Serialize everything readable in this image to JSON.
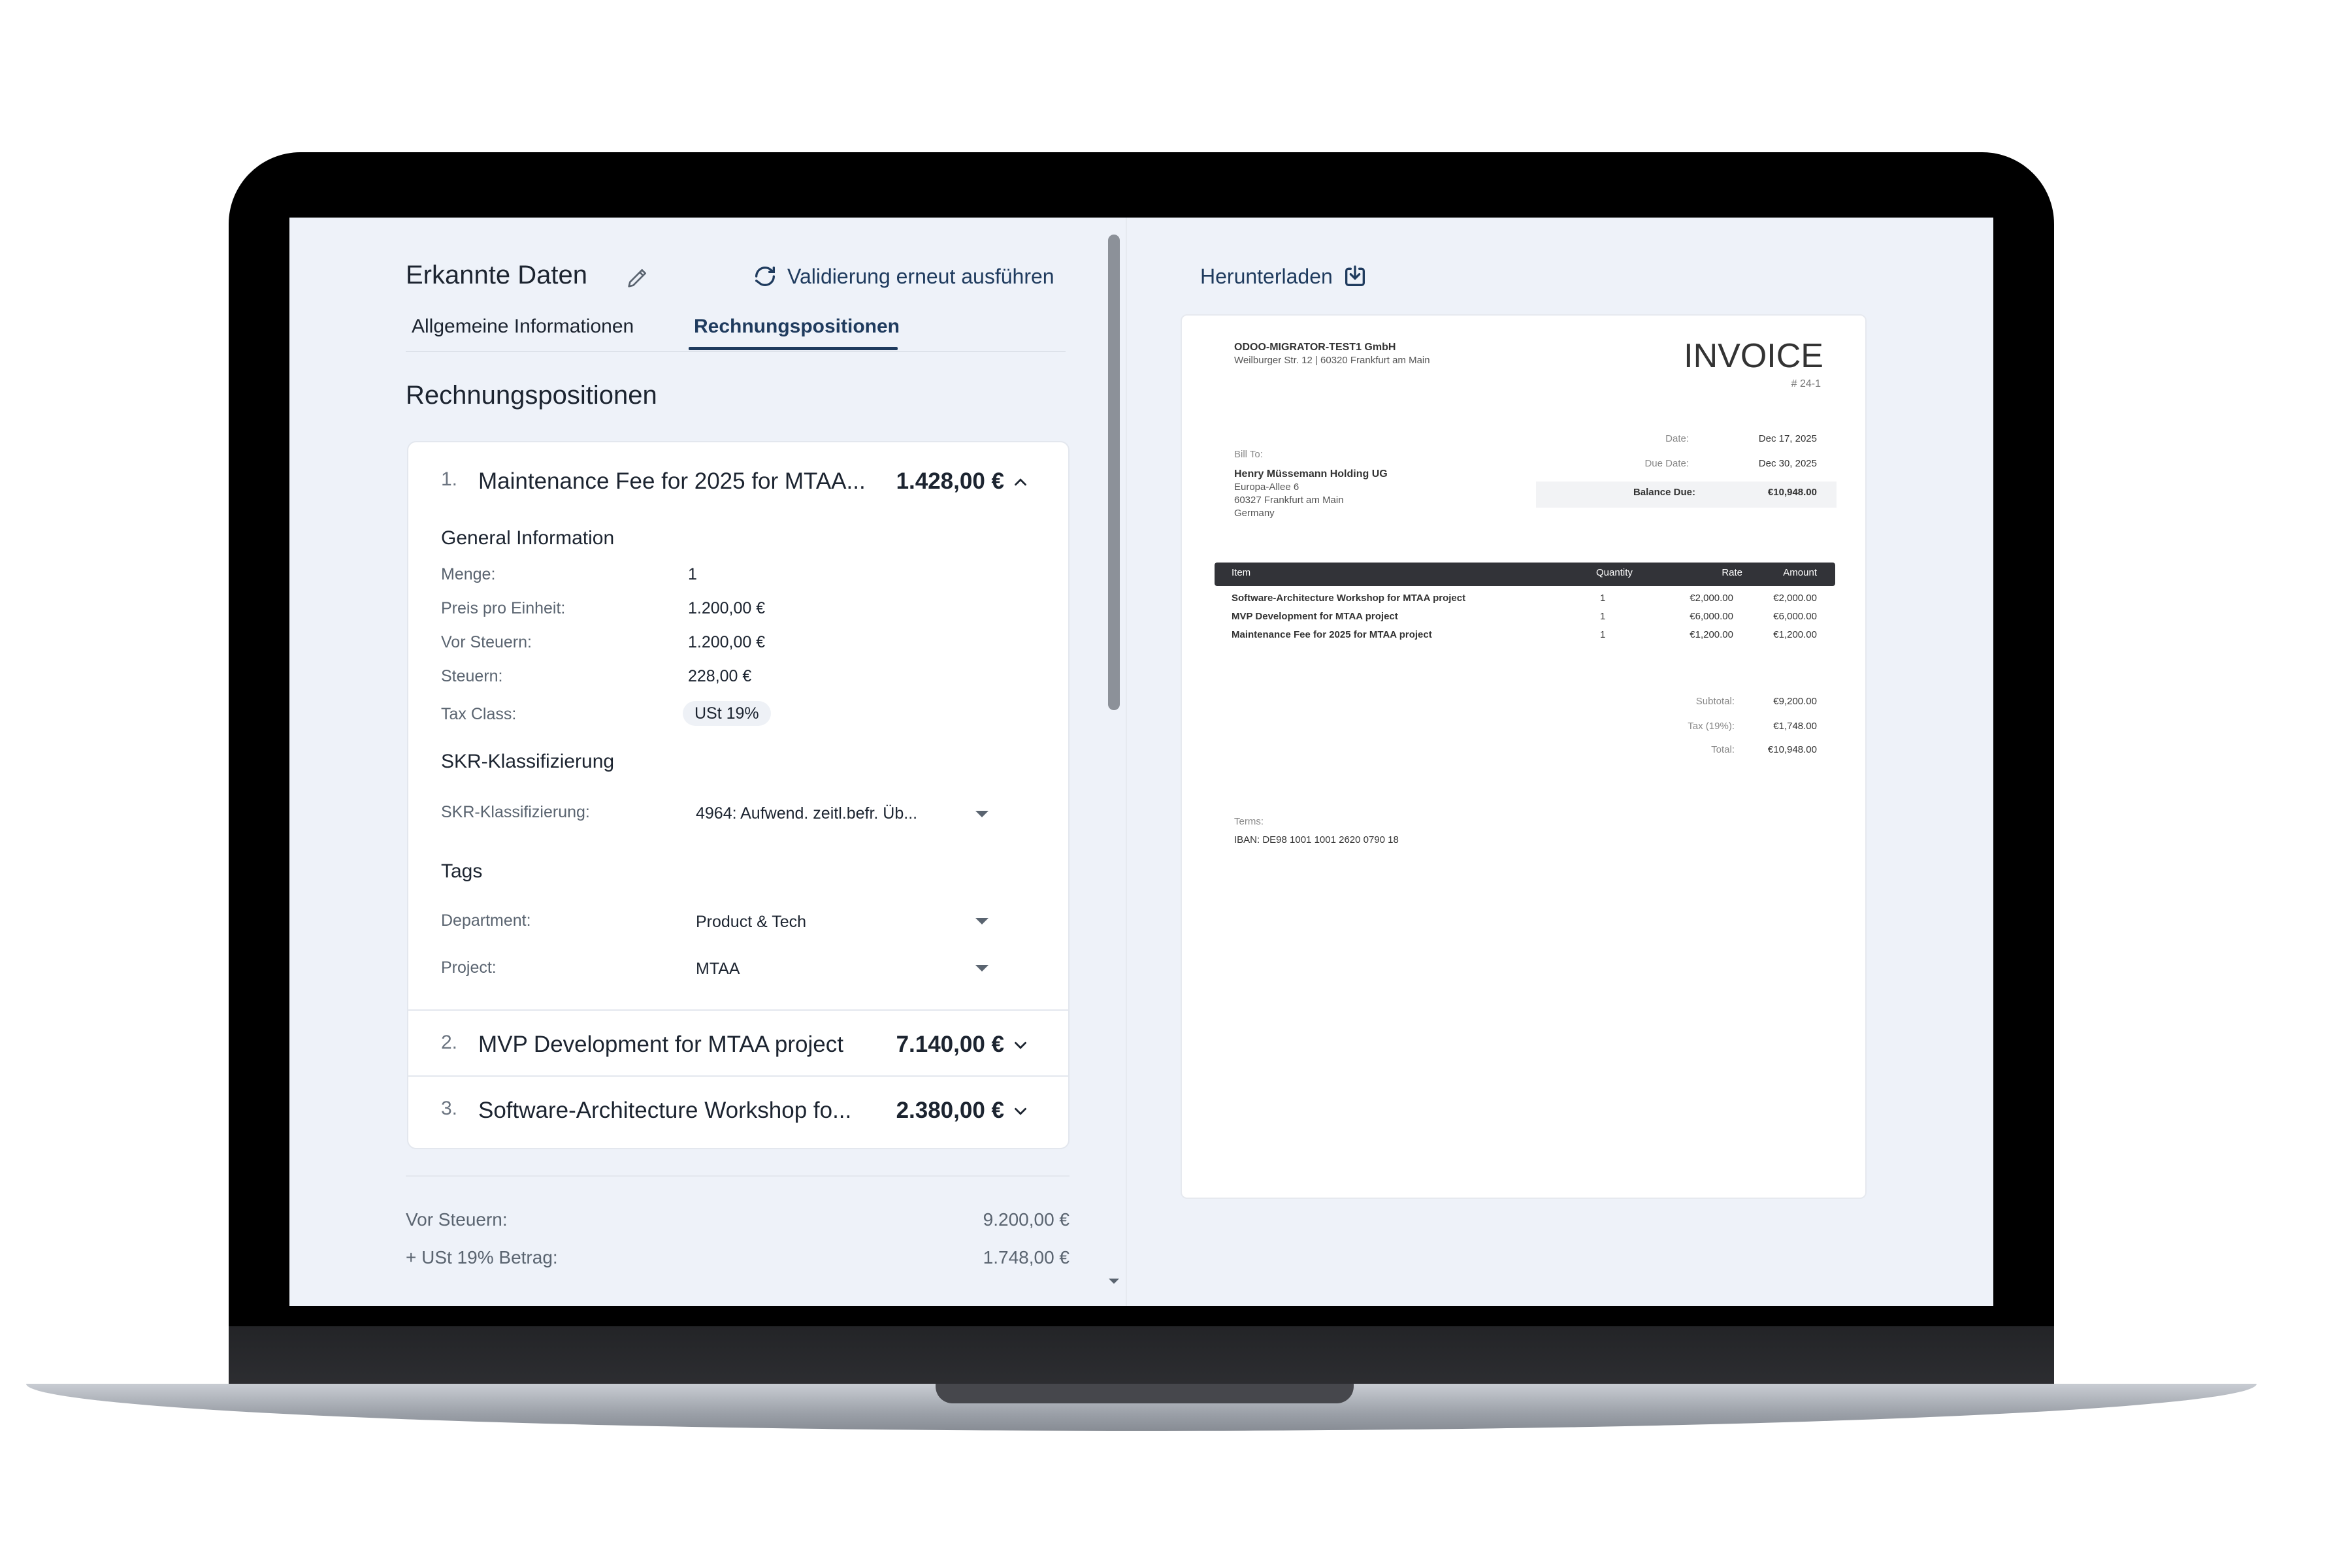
{
  "header": {
    "title": "Erkannte Daten",
    "revalidate_label": "Validierung erneut ausführen"
  },
  "tabs": [
    {
      "label": "Allgemeine Informationen",
      "active": false
    },
    {
      "label": "Rechnungspositionen",
      "active": true
    }
  ],
  "section_title": "Rechnungspositionen",
  "positions": [
    {
      "number": "1.",
      "title": "Maintenance Fee for 2025 for MTAA...",
      "amount": "1.428,00 €",
      "expanded": true,
      "general_title": "General Information",
      "fields": [
        {
          "label": "Menge:",
          "value": "1"
        },
        {
          "label": "Preis pro Einheit:",
          "value": "1.200,00 €"
        },
        {
          "label": "Vor Steuern:",
          "value": "1.200,00 €"
        },
        {
          "label": "Steuern:",
          "value": "228,00 €"
        },
        {
          "label": "Tax Class:",
          "value": "USt 19%"
        }
      ],
      "skr_title": "SKR-Klassifizierung",
      "skr_label": "SKR-Klassifizierung:",
      "skr_value": "4964: Aufwend. zeitl.befr. Üb...",
      "tags_title": "Tags",
      "tags": [
        {
          "label": "Department:",
          "value": "Product & Tech"
        },
        {
          "label": "Project:",
          "value": "MTAA"
        }
      ]
    },
    {
      "number": "2.",
      "title": "MVP Development for MTAA project",
      "amount": "7.140,00 €",
      "expanded": false
    },
    {
      "number": "3.",
      "title": "Software-Architecture Workshop fo...",
      "amount": "2.380,00 €",
      "expanded": false
    }
  ],
  "totals": [
    {
      "label": "Vor Steuern:",
      "value": "9.200,00 €"
    },
    {
      "label": "+ USt 19% Betrag:",
      "value": "1.748,00 €"
    }
  ],
  "preview": {
    "download_label": "Herunterladen",
    "company": "ODOO-MIGRATOR-TEST1 GmbH",
    "company_address": "Weilburger Str. 12 | 60320 Frankfurt am Main",
    "doc_title": "INVOICE",
    "doc_number": "# 24-1",
    "date_label": "Date:",
    "date": "Dec 17, 2025",
    "due_label": "Due Date:",
    "due_date": "Dec 30, 2025",
    "balance_label": "Balance Due:",
    "balance": "€10,948.00",
    "bill_to_label": "Bill To:",
    "client_name": "Henry Müssemann Holding UG",
    "client_address": [
      "Europa-Allee 6",
      "60327 Frankfurt am Main",
      "Germany"
    ],
    "columns": [
      "Item",
      "Quantity",
      "Rate",
      "Amount"
    ],
    "items": [
      {
        "name": "Software-Architecture Workshop for MTAA project",
        "qty": "1",
        "rate": "€2,000.00",
        "amount": "€2,000.00"
      },
      {
        "name": "MVP Development for MTAA project",
        "qty": "1",
        "rate": "€6,000.00",
        "amount": "€6,000.00"
      },
      {
        "name": "Maintenance Fee for 2025 for MTAA project",
        "qty": "1",
        "rate": "€1,200.00",
        "amount": "€1,200.00"
      }
    ],
    "subtotal_label": "Subtotal:",
    "subtotal": "€9,200.00",
    "tax_label": "Tax (19%):",
    "tax": "€1,748.00",
    "total_label": "Total:",
    "total": "€10,948.00",
    "terms_label": "Terms:",
    "iban": "IBAN: DE98 1001 1001 2620 0790 18"
  },
  "colors": {
    "accent": "#1f3b5e",
    "screen_bg": "#eef2f9",
    "text": "#1c2430",
    "muted": "#5a6470"
  }
}
